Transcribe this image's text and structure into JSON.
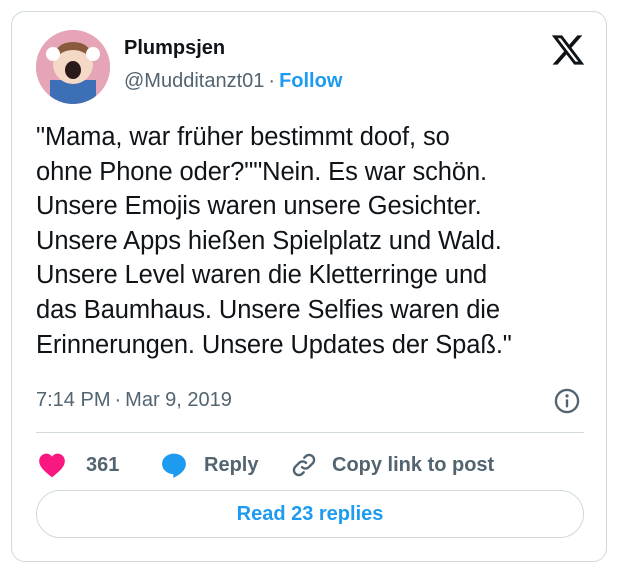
{
  "user": {
    "display_name": "Plumpsjen",
    "handle": "@Mudditanzt01",
    "separator": "·",
    "follow_label": "Follow"
  },
  "tweet": {
    "text": "\"Mama, war früher bestimmt doof, so\nohne Phone oder?\"\"Nein. Es war schön.\nUnsere Emojis waren unsere Gesichter.\nUnsere Apps hießen Spielplatz und Wald.\nUnsere Level waren die Kletterringe und\ndas Baumhaus. Unsere Selfies waren die\nErinnerungen. Unsere Updates der Spaß.\"",
    "time": "7:14 PM",
    "separator": "·",
    "date": "Mar 9, 2019"
  },
  "actions": {
    "like_count": "361",
    "reply_label": "Reply",
    "copy_label": "Copy link to post"
  },
  "read_replies_label": "Read 23 replies",
  "colors": {
    "accent": "#1d9bf0",
    "like": "#f91880",
    "secondary_text": "#536471",
    "border": "#cfd9de"
  },
  "icons": [
    "x-logo-icon",
    "info-icon",
    "heart-icon",
    "reply-bubble-icon",
    "link-icon"
  ]
}
